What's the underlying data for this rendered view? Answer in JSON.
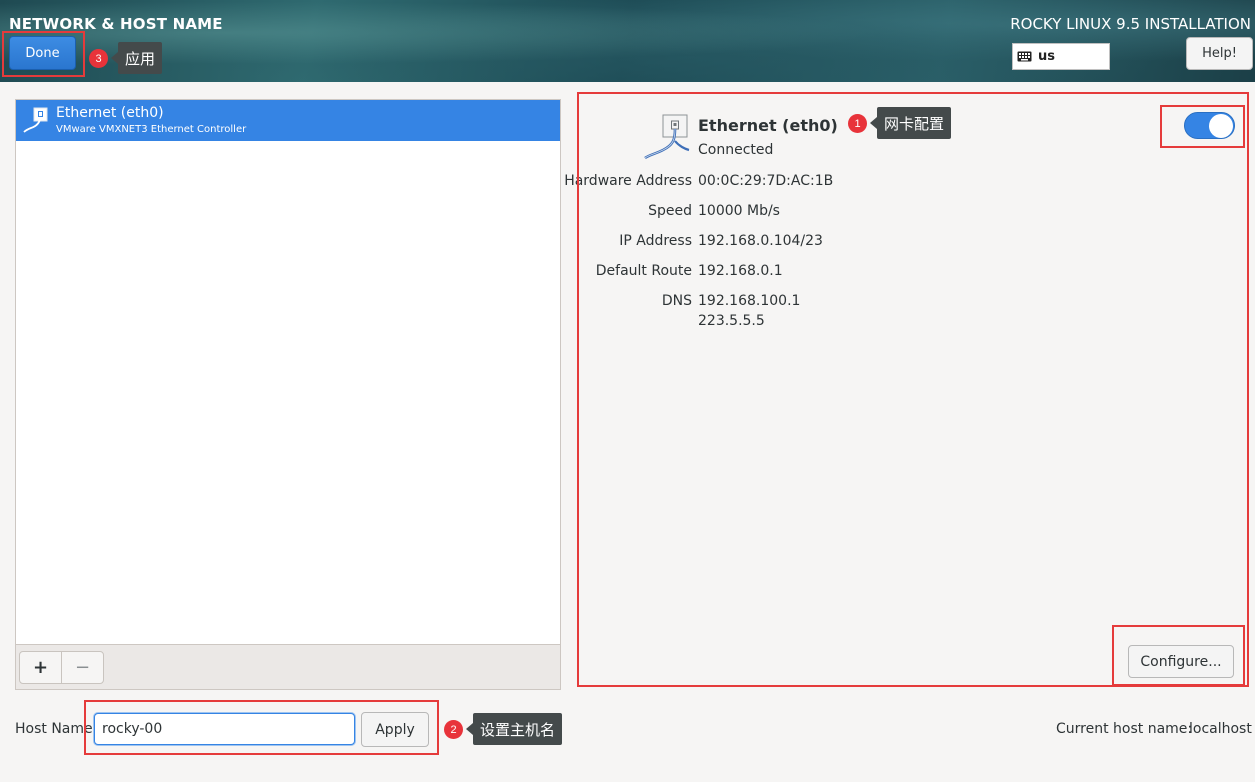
{
  "header": {
    "title": "NETWORK & HOST NAME",
    "installation": "ROCKY LINUX 9.5 INSTALLATION",
    "done_label": "Done",
    "keyboard_layout": "us",
    "help_label": "Help!"
  },
  "devices": [
    {
      "name": "Ethernet (eth0)",
      "description": "VMware VMXNET3 Ethernet Controller",
      "selected": true
    }
  ],
  "list_tools": {
    "add": "+",
    "remove": "−"
  },
  "detail": {
    "name": "Ethernet (eth0)",
    "status": "Connected",
    "enabled": true,
    "rows": [
      {
        "label": "Hardware Address",
        "value": "00:0C:29:7D:AC:1B"
      },
      {
        "label": "Speed",
        "value": "10000 Mb/s"
      },
      {
        "label": "IP Address",
        "value": "192.168.0.104/23"
      },
      {
        "label": "Default Route",
        "value": "192.168.0.1"
      },
      {
        "label": "DNS",
        "value": "192.168.100.1",
        "value2": "223.5.5.5"
      }
    ],
    "configure_label": "Configure..."
  },
  "hostname": {
    "label": "Host Name",
    "value": "rocky-00",
    "apply_label": "Apply",
    "current_label": "Current host name:",
    "current_value": "localhost"
  },
  "annotations": [
    {
      "number": "1",
      "text": "网卡配置"
    },
    {
      "number": "2",
      "text": "设置主机名"
    },
    {
      "number": "3",
      "text": "应用"
    }
  ],
  "colors": {
    "accent": "#3584e4",
    "annotation_red": "#e53b3b",
    "tooltip_bg": "#444a4b"
  }
}
